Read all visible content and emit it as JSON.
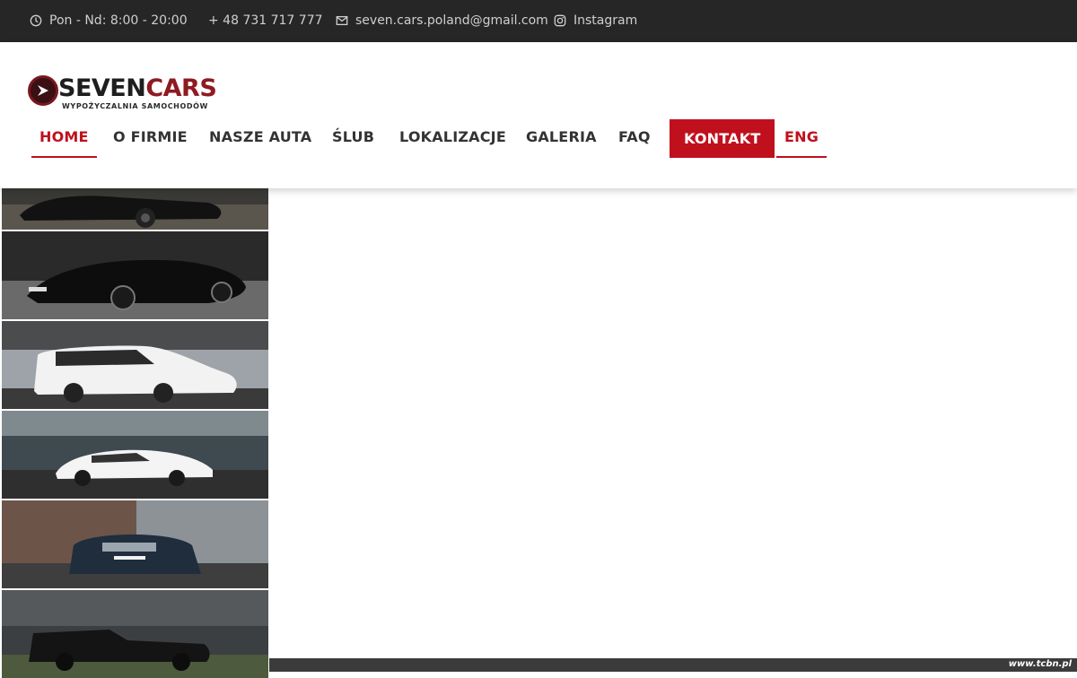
{
  "topbar": {
    "hours": "Pon - Nd: 8:00 - 20:00",
    "phone": "+ 48 731 717 777",
    "email": "seven.cars.poland@gmail.com",
    "instagram": "Instagram"
  },
  "logo": {
    "word_a": "SEVEN",
    "word_b": "CARS",
    "tagline": "WYPOŻYCZALNIA SAMOCHODÓW"
  },
  "nav": {
    "items": [
      {
        "label": "HOME"
      },
      {
        "label": "O FIRMIE"
      },
      {
        "label": "NASZE AUTA"
      },
      {
        "label": "ŚLUB"
      },
      {
        "label": "LOKALIZACJE"
      },
      {
        "label": "GALERIA"
      },
      {
        "label": "FAQ"
      },
      {
        "label": "KONTAKT"
      },
      {
        "label": "ENG"
      }
    ]
  },
  "colors": {
    "accent": "#c0101d",
    "topbar": "#262626",
    "logo_red": "#8e1a22"
  },
  "credit": "www.tcbn.pl"
}
